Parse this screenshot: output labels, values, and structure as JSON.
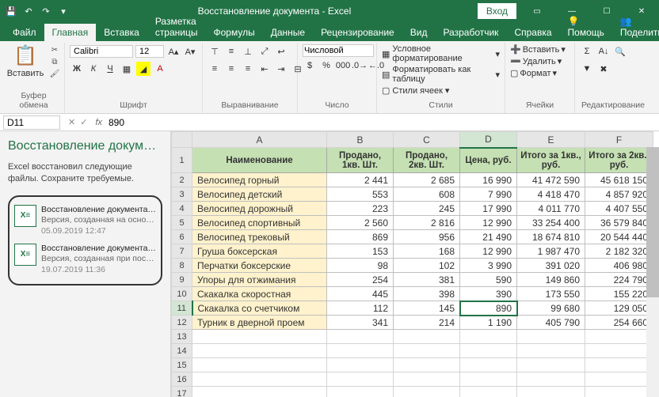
{
  "titlebar": {
    "title": "Восстановление документа - Excel",
    "signin": "Вход"
  },
  "tabs": {
    "file": "Файл",
    "home": "Главная",
    "insert": "Вставка",
    "layout": "Разметка страницы",
    "formulas": "Формулы",
    "data": "Данные",
    "review": "Рецензирование",
    "view": "Вид",
    "developer": "Разработчик",
    "help": "Справка",
    "tellme": "Помощь",
    "share": "Поделиться"
  },
  "ribbon": {
    "clipboard": {
      "label": "Буфер обмена",
      "paste": "Вставить"
    },
    "font": {
      "label": "Шрифт",
      "name": "Calibri",
      "size": "12"
    },
    "align": {
      "label": "Выравнивание"
    },
    "number": {
      "label": "Число",
      "format": "Числовой"
    },
    "styles": {
      "label": "Стили",
      "cond": "Условное форматирование",
      "table": "Форматировать как таблицу",
      "cell": "Стили ячеек"
    },
    "cells": {
      "label": "Ячейки",
      "insert": "Вставить",
      "delete": "Удалить",
      "format": "Формат"
    },
    "editing": {
      "label": "Редактирование"
    }
  },
  "formula_bar": {
    "namebox": "D11",
    "value": "890"
  },
  "recovery": {
    "title": "Восстановление докуме…",
    "subtitle": "Excel восстановил следующие файлы. Сохраните требуемые.",
    "items": [
      {
        "name": "Восстановление документа…",
        "ver": "Версия, созданная на основ…",
        "date": "05.09.2019 12:47"
      },
      {
        "name": "Восстановление документа…",
        "ver": "Версия, созданная при посл…",
        "date": "19.07.2019 11:36"
      }
    ]
  },
  "sheet": {
    "cols": [
      "A",
      "B",
      "C",
      "D",
      "E",
      "F"
    ],
    "headers": [
      "Наименование",
      "Продано, 1кв. Шт.",
      "Продано, 2кв. Шт.",
      "Цена, руб.",
      "Итого за 1кв., руб.",
      "Итого за 2кв., руб."
    ],
    "rows": [
      {
        "n": 2,
        "name": "Велосипед горный",
        "c": [
          "2 441",
          "2 685",
          "16 990",
          "41 472 590",
          "45 618 150"
        ]
      },
      {
        "n": 3,
        "name": "Велосипед детский",
        "c": [
          "553",
          "608",
          "7 990",
          "4 418 470",
          "4 857 920"
        ]
      },
      {
        "n": 4,
        "name": "Велосипед дорожный",
        "c": [
          "223",
          "245",
          "17 990",
          "4 011 770",
          "4 407 550"
        ]
      },
      {
        "n": 5,
        "name": "Велосипед спортивный",
        "c": [
          "2 560",
          "2 816",
          "12 990",
          "33 254 400",
          "36 579 840"
        ]
      },
      {
        "n": 6,
        "name": "Велосипед трековый",
        "c": [
          "869",
          "956",
          "21 490",
          "18 674 810",
          "20 544 440"
        ]
      },
      {
        "n": 7,
        "name": "Груша боксерская",
        "c": [
          "153",
          "168",
          "12 990",
          "1 987 470",
          "2 182 320"
        ]
      },
      {
        "n": 8,
        "name": "Перчатки боксерские",
        "c": [
          "98",
          "102",
          "3 990",
          "391 020",
          "406 980"
        ]
      },
      {
        "n": 9,
        "name": "Упоры для отжимания",
        "c": [
          "254",
          "381",
          "590",
          "149 860",
          "224 790"
        ]
      },
      {
        "n": 10,
        "name": "Скакалка скоростная",
        "c": [
          "445",
          "398",
          "390",
          "173 550",
          "155 220"
        ]
      },
      {
        "n": 11,
        "name": "Скакалка со счетчиком",
        "c": [
          "112",
          "145",
          "890",
          "99 680",
          "129 050"
        ]
      },
      {
        "n": 12,
        "name": "Турник в дверной проем",
        "c": [
          "341",
          "214",
          "1 190",
          "405 790",
          "254 660"
        ]
      }
    ],
    "blank_rows": [
      13,
      14,
      15,
      16,
      17
    ],
    "selected": {
      "row": 11,
      "col": "D"
    }
  }
}
